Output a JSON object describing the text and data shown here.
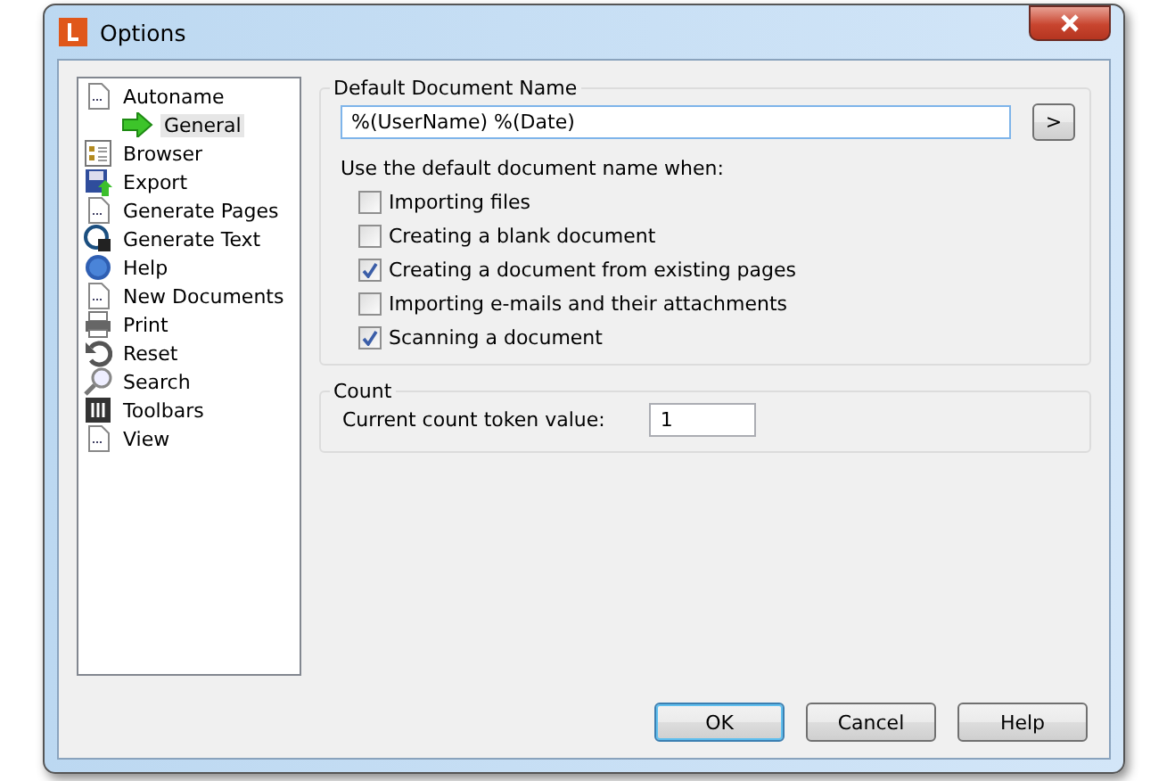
{
  "window": {
    "title": "Options"
  },
  "tree": [
    {
      "label": "Autoname",
      "selected": false,
      "children": [
        {
          "label": "General",
          "selected": true
        }
      ]
    },
    {
      "label": "Browser",
      "selected": false
    },
    {
      "label": "Export",
      "selected": false
    },
    {
      "label": "Generate Pages",
      "selected": false
    },
    {
      "label": "Generate Text",
      "selected": false
    },
    {
      "label": "Help",
      "selected": false
    },
    {
      "label": "New Documents",
      "selected": false
    },
    {
      "label": "Print",
      "selected": false
    },
    {
      "label": "Reset",
      "selected": false
    },
    {
      "label": "Search",
      "selected": false
    },
    {
      "label": "Toolbars",
      "selected": false
    },
    {
      "label": "View",
      "selected": false
    }
  ],
  "default_name": {
    "title": "Default Document Name",
    "value": "%(UserName) %(Date)",
    "insert_button": ">",
    "prompt": "Use the default document name when:",
    "options": [
      {
        "label": "Importing files",
        "checked": false
      },
      {
        "label": "Creating a blank document",
        "checked": false
      },
      {
        "label": "Creating a document from existing pages",
        "checked": true
      },
      {
        "label": "Importing e-mails and their attachments",
        "checked": false
      },
      {
        "label": "Scanning a document",
        "checked": true
      }
    ]
  },
  "count": {
    "title": "Count",
    "label": "Current count token value:",
    "value": "1"
  },
  "buttons": [
    {
      "label": "OK",
      "default": true
    },
    {
      "label": "Cancel",
      "default": false
    },
    {
      "label": "Help",
      "default": false
    }
  ]
}
